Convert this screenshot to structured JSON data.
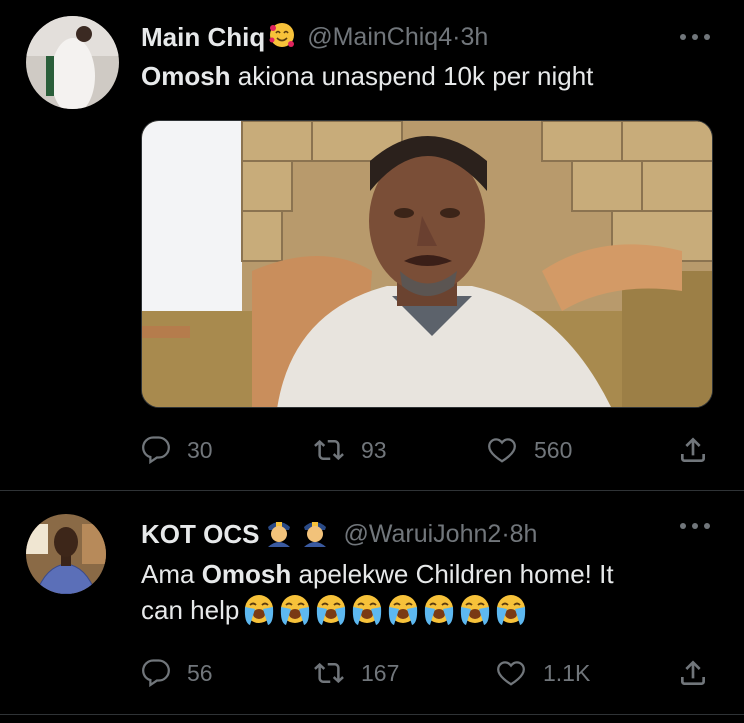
{
  "tweets": [
    {
      "display_name": "Main Chiq",
      "handle": "@MainChiq4",
      "time": "3h",
      "text_bold": "Omosh",
      "text_rest": " akiona unaspend 10k per night",
      "replies": "30",
      "retweets": "93",
      "likes": "560"
    },
    {
      "display_name": "KOT OCS",
      "handle": "@WaruiJohn2",
      "time": "8h",
      "text_pre": "Ama ",
      "text_bold": "Omosh",
      "text_rest_line1": " apelekwe Children home! It",
      "text_line2": "can help",
      "replies": "56",
      "retweets": "167",
      "likes": "1.1K"
    }
  ],
  "separator": " · ",
  "colors": {
    "background": "#000000",
    "primary_text": "#e7e9ea",
    "secondary_text": "#71767b",
    "divider": "#2f3336"
  },
  "icons": [
    "reply-icon",
    "retweet-icon",
    "like-icon",
    "share-icon",
    "more-icon",
    "smiling-face-with-hearts-emoji",
    "police-officer-emoji",
    "loudly-crying-face-emoji"
  ]
}
